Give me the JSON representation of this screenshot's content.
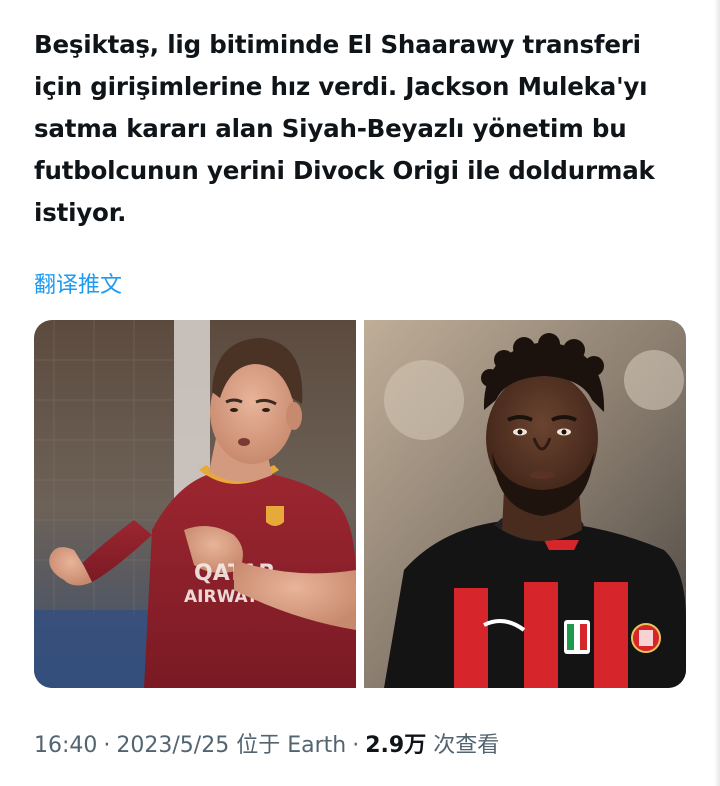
{
  "tweet": {
    "text": "Beşiktaş, lig bitiminde El Shaarawy transferi için girişimlerine hız verdi. Jackson Muleka'yı satma kararı alan Siyah-Beyazlı yönetim bu futbolcunun yerini Divock Origi ile doldurmak istiyor.",
    "translate_label": "翻译推文",
    "time": "16:40",
    "date": "2023/5/25",
    "location": "位于 Earth",
    "views_count": "2.9万",
    "views_label": "次查看",
    "separator": "·"
  },
  "media": {
    "left_jersey_text": "QATAR AIRWAYS",
    "colors": {
      "link": "#1d9bf0",
      "meta": "#536471",
      "roma_red": "#8b1e2a",
      "milan_red": "#d7262b"
    }
  }
}
